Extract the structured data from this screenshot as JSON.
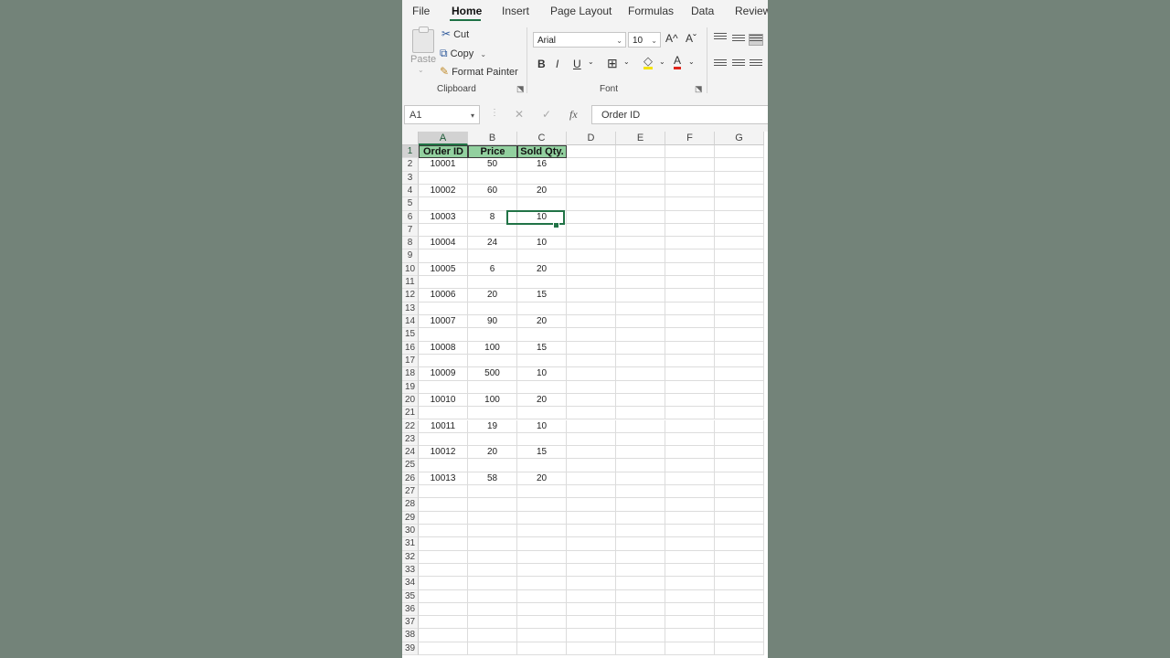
{
  "menu": {
    "tabs": [
      {
        "label": "File"
      },
      {
        "label": "Home"
      },
      {
        "label": "Insert"
      },
      {
        "label": "Page Layout"
      },
      {
        "label": "Formulas"
      },
      {
        "label": "Data"
      },
      {
        "label": "Review"
      }
    ],
    "active_tab": "Home"
  },
  "ribbon": {
    "clipboard": {
      "paste_label": "Paste",
      "cut_label": "Cut",
      "copy_label": "Copy",
      "format_painter_label": "Format Painter",
      "group_label": "Clipboard"
    },
    "font": {
      "font_name": "Arial",
      "font_size": "10",
      "bold_label": "B",
      "italic_label": "I",
      "underline_label": "U",
      "grow_label": "A^",
      "shrink_label": "Aˇ",
      "font_color_label": "A",
      "group_label": "Font"
    }
  },
  "formula_bar": {
    "name_box": "A1",
    "fx_label": "fx",
    "cancel_label": "✕",
    "enter_label": "✓",
    "formula": "Order ID"
  },
  "sheet": {
    "columns": [
      "A",
      "B",
      "C",
      "D",
      "E",
      "F",
      "G"
    ],
    "header_row": [
      "Order ID",
      "Price",
      "Sold Qty."
    ],
    "rows": [
      {
        "row": 2,
        "cells": [
          "10001",
          "50",
          "16"
        ]
      },
      {
        "row": 3,
        "cells": [
          "",
          "",
          ""
        ]
      },
      {
        "row": 4,
        "cells": [
          "10002",
          "60",
          "20"
        ]
      },
      {
        "row": 5,
        "cells": [
          "",
          "",
          ""
        ]
      },
      {
        "row": 6,
        "cells": [
          "10003",
          "8",
          "10"
        ]
      },
      {
        "row": 7,
        "cells": [
          "",
          "",
          ""
        ]
      },
      {
        "row": 8,
        "cells": [
          "10004",
          "24",
          "10"
        ]
      },
      {
        "row": 9,
        "cells": [
          "",
          "",
          ""
        ]
      },
      {
        "row": 10,
        "cells": [
          "10005",
          "6",
          "20"
        ]
      },
      {
        "row": 11,
        "cells": [
          "",
          "",
          ""
        ]
      },
      {
        "row": 12,
        "cells": [
          "10006",
          "20",
          "15"
        ]
      },
      {
        "row": 13,
        "cells": [
          "",
          "",
          ""
        ]
      },
      {
        "row": 14,
        "cells": [
          "10007",
          "90",
          "20"
        ]
      },
      {
        "row": 15,
        "cells": [
          "",
          "",
          ""
        ]
      },
      {
        "row": 16,
        "cells": [
          "10008",
          "100",
          "15"
        ]
      },
      {
        "row": 17,
        "cells": [
          "",
          "",
          ""
        ]
      },
      {
        "row": 18,
        "cells": [
          "10009",
          "500",
          "10"
        ]
      },
      {
        "row": 19,
        "cells": [
          "",
          "",
          ""
        ]
      },
      {
        "row": 20,
        "cells": [
          "10010",
          "100",
          "20"
        ]
      },
      {
        "row": 21,
        "cells": [
          "",
          "",
          ""
        ]
      },
      {
        "row": 22,
        "cells": [
          "10011",
          "19",
          "10"
        ]
      },
      {
        "row": 23,
        "cells": [
          "",
          "",
          ""
        ]
      },
      {
        "row": 24,
        "cells": [
          "10012",
          "20",
          "15"
        ]
      },
      {
        "row": 25,
        "cells": [
          "",
          "",
          ""
        ]
      },
      {
        "row": 26,
        "cells": [
          "10013",
          "58",
          "20"
        ]
      }
    ],
    "last_visible_row": 39,
    "selected_cell": "C6",
    "header_fill": "#92d09f",
    "accent": "#217346"
  }
}
